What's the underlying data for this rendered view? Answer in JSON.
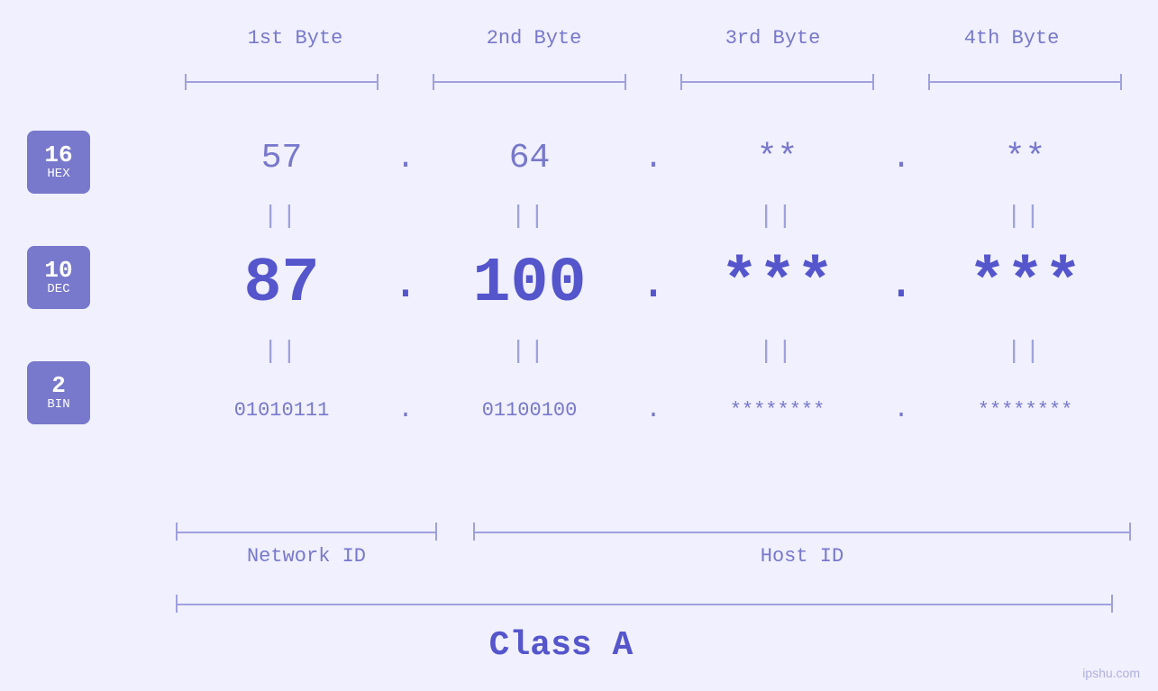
{
  "headers": {
    "byte1": "1st Byte",
    "byte2": "2nd Byte",
    "byte3": "3rd Byte",
    "byte4": "4th Byte"
  },
  "bases": [
    {
      "number": "16",
      "name": "HEX"
    },
    {
      "number": "10",
      "name": "DEC"
    },
    {
      "number": "2",
      "name": "BIN"
    }
  ],
  "hex_row": {
    "b1": "57",
    "b2": "64",
    "b3": "**",
    "b4": "**"
  },
  "dec_row": {
    "b1": "87",
    "b2": "100",
    "b3": "***",
    "b4": "***"
  },
  "bin_row": {
    "b1": "01010111",
    "b2": "01100100",
    "b3": "********",
    "b4": "********"
  },
  "labels": {
    "network_id": "Network ID",
    "host_id": "Host ID",
    "class": "Class A"
  },
  "watermark": "ipshu.com",
  "equals": "||",
  "dot": "."
}
